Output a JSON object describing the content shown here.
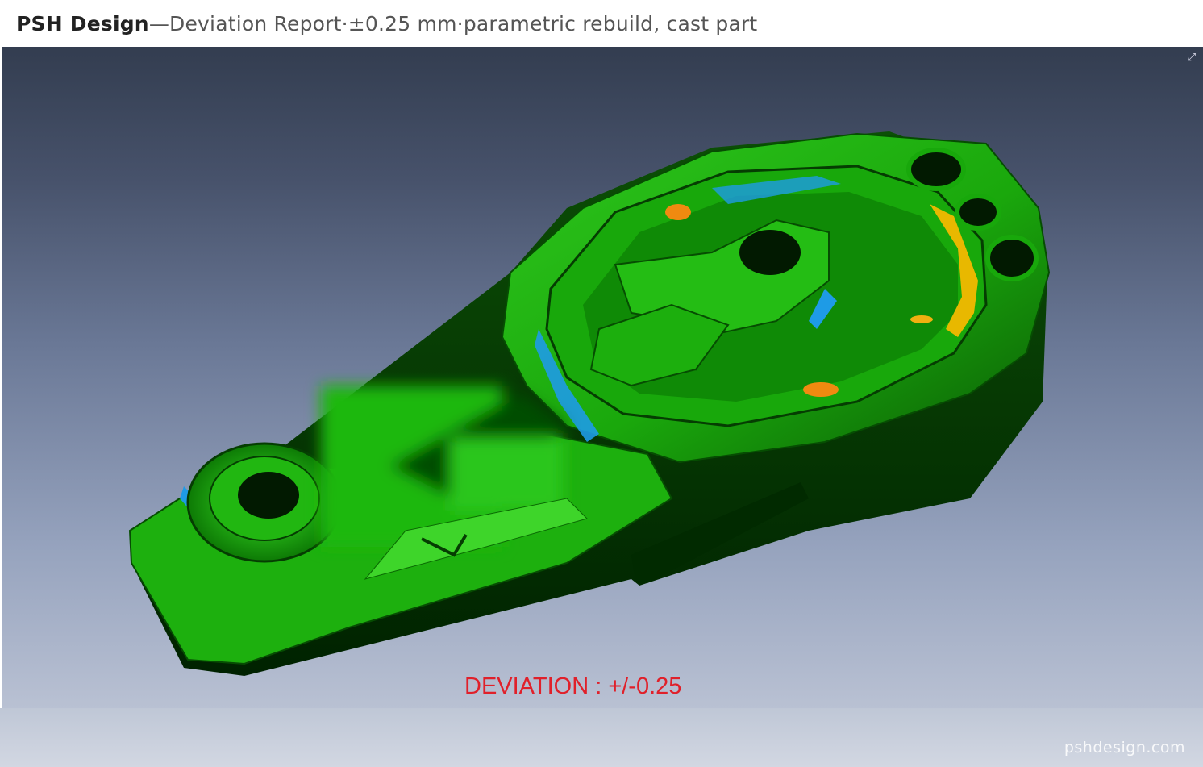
{
  "header": {
    "brand": "PSH Design",
    "dash": " — ",
    "report": "Deviation Report",
    "dot1": "  ·  ",
    "tolerance": "±0.25 mm",
    "dot2": "  ·  ",
    "description": "parametric rebuild, cast part"
  },
  "viewport": {
    "deviation_label": "DEVIATION : +/-0.25",
    "expand_icon": "expand-icon"
  },
  "footer": {
    "watermark": "pshdesign.com"
  },
  "colors": {
    "in_tolerance": "#1fb80f",
    "shadow": "#003300",
    "low_deviation": "#1e9be6",
    "high_deviation": "#e8b800",
    "out_of_tolerance": "#f08a10",
    "label": "#e0202a"
  }
}
